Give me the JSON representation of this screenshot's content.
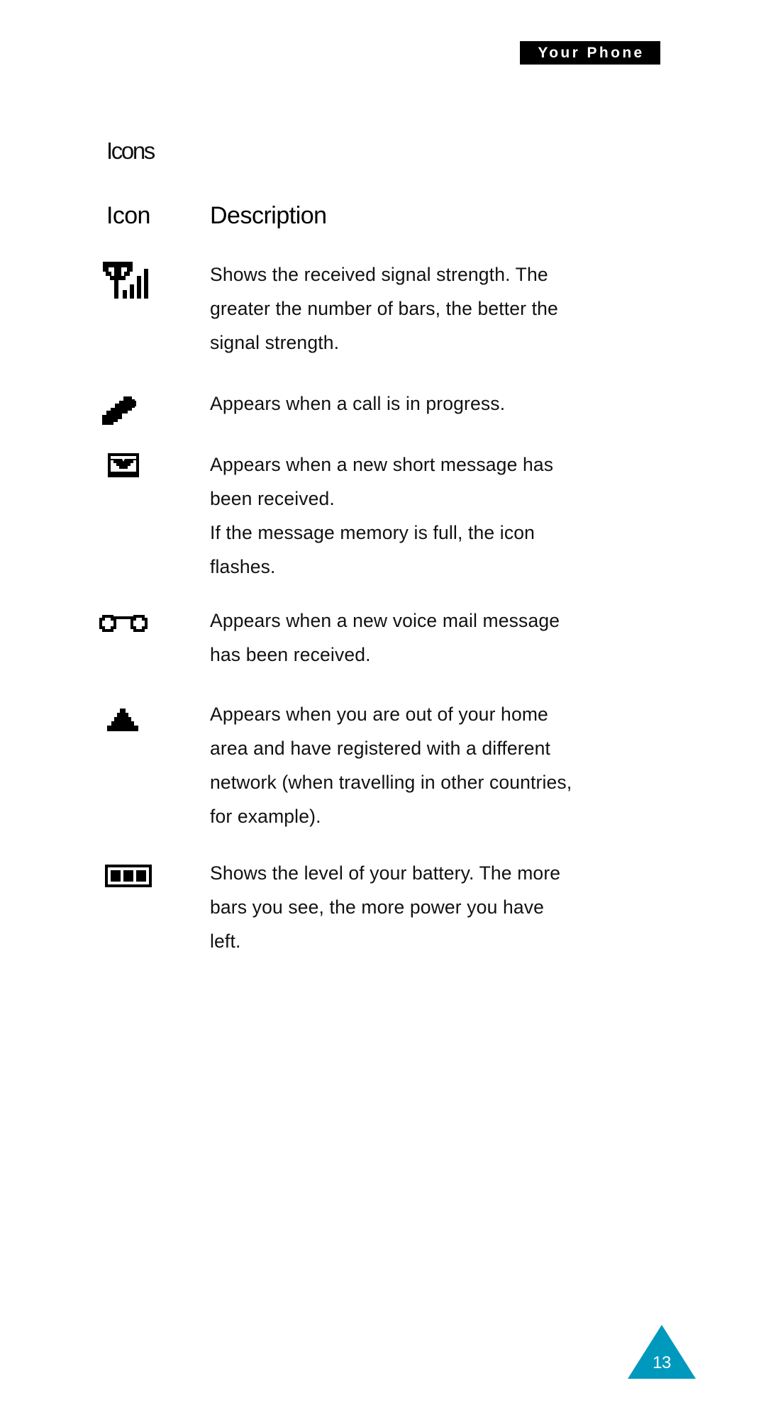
{
  "header": {
    "running_head": "Your Phone"
  },
  "section": {
    "heading": "Icons"
  },
  "table": {
    "columns": {
      "icon": "Icon",
      "description": "Description"
    },
    "rows": [
      {
        "icon_name": "signal-strength-icon",
        "lines": [
          "Shows the received signal strength. The",
          "greater the number of bars, the better the",
          "signal strength."
        ]
      },
      {
        "icon_name": "call-in-progress-icon",
        "lines": [
          "Appears when a call is in progress."
        ]
      },
      {
        "icon_name": "new-short-message-icon",
        "lines": [
          "Appears when a new short message has",
          "been received.",
          "If the message memory is full, the icon",
          "flashes."
        ]
      },
      {
        "icon_name": "voice-mail-icon",
        "lines": [
          "Appears when a new voice mail message",
          "has been received."
        ]
      },
      {
        "icon_name": "roaming-icon",
        "lines": [
          "Appears when you are out of your home",
          "area and have registered with a different",
          "network (when travelling in other countries,",
          "for example)."
        ]
      },
      {
        "icon_name": "battery-level-icon",
        "lines": [
          "Shows the level of your battery. The more",
          "bars you see, the more power you have",
          "left."
        ]
      }
    ]
  },
  "footer": {
    "page_number": "13"
  },
  "colors": {
    "page_badge": "#0099BE",
    "header_tab_bg": "#000000",
    "header_tab_text": "#FFFFFF",
    "text": "#111111"
  }
}
